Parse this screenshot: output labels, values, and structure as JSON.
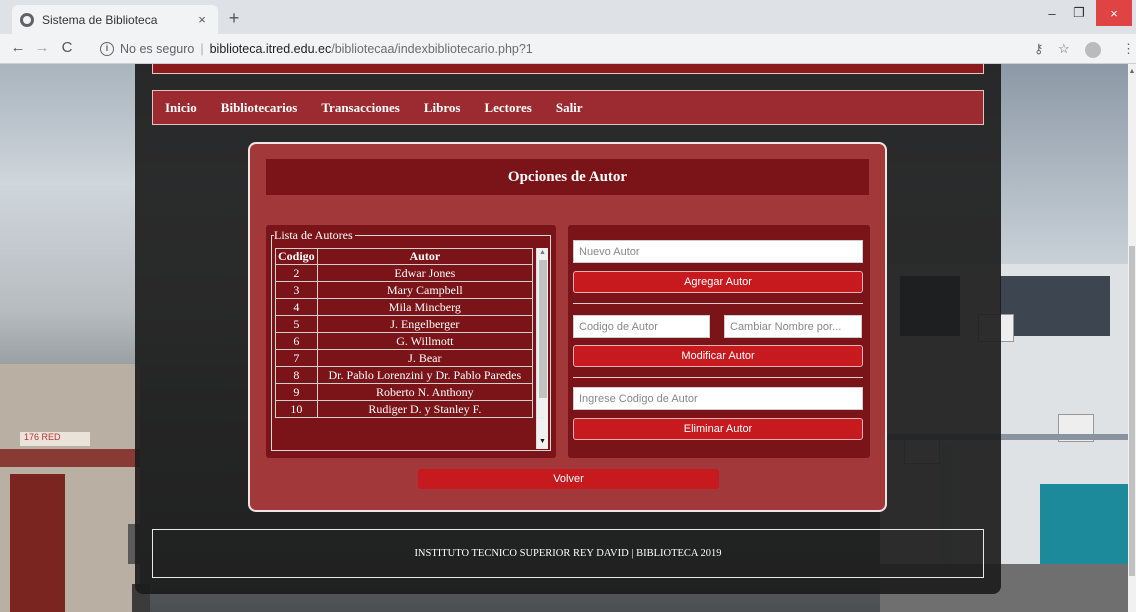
{
  "browser": {
    "tab_title": "Sistema de Biblioteca",
    "tab_close": "×",
    "new_tab": "+",
    "not_secure": "No es seguro",
    "separator": "|",
    "url_host": "biblioteca.itred.edu.ec",
    "url_path": "/bibliotecaa/indexbibliotecario.php?1",
    "win_min": "–",
    "win_max": "❐",
    "win_close": "×",
    "back": "←",
    "forward": "→",
    "reload": "C",
    "info": "i",
    "key_icon": "⚷",
    "star_icon": "☆",
    "menu_icon": "⋮"
  },
  "background": {
    "sign_text": "176 RED"
  },
  "nav": {
    "items": [
      {
        "label": "Inicio"
      },
      {
        "label": "Bibliotecarios"
      },
      {
        "label": "Transacciones"
      },
      {
        "label": "Libros"
      },
      {
        "label": "Lectores"
      },
      {
        "label": "Salir"
      }
    ]
  },
  "panel": {
    "title": "Opciones de Autor",
    "list": {
      "legend": "Lista de Autores",
      "headers": {
        "code": "Codigo",
        "author": "Autor"
      },
      "rows": [
        {
          "code": "2",
          "author": "Edwar Jones"
        },
        {
          "code": "3",
          "author": "Mary Campbell"
        },
        {
          "code": "4",
          "author": "Mila Mincberg"
        },
        {
          "code": "5",
          "author": "J. Engelberger"
        },
        {
          "code": "6",
          "author": "G. Willmott"
        },
        {
          "code": "7",
          "author": "J. Bear"
        },
        {
          "code": "8",
          "author": "Dr. Pablo Lorenzini y Dr. Pablo Paredes"
        },
        {
          "code": "9",
          "author": "Roberto N. Anthony"
        },
        {
          "code": "10",
          "author": "Rudiger D. y Stanley F."
        }
      ]
    },
    "form": {
      "new_author_placeholder": "Nuevo Autor",
      "add_button": "Agregar Autor",
      "author_code_placeholder": "Codigo de Autor",
      "rename_placeholder": "Cambiar Nombre por...",
      "modify_button": "Modificar Autor",
      "delete_code_placeholder": "Ingrese Codigo de Autor",
      "delete_button": "Eliminar Autor"
    },
    "back_button": "Volver"
  },
  "footer": {
    "text": "INSTITUTO TECNICO SUPERIOR REY DAVID | BIBLIOTECA 2019"
  },
  "colors": {
    "dark_red": "#7a1418",
    "panel_red": "#a3383b",
    "button_red": "#c61a1f",
    "nav_red": "#9b2b30"
  }
}
